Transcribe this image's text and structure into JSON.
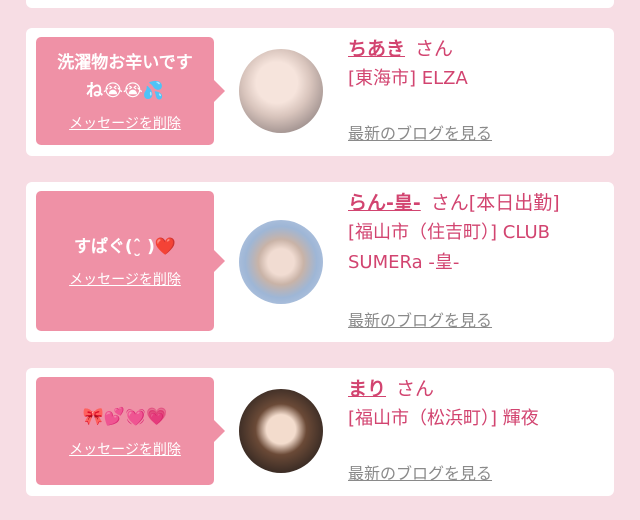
{
  "favorites": [
    {
      "message": "洗濯物お辛いです\nね😭😭💦",
      "delete_label": "メッセージを削除",
      "name": "ちあき",
      "honorific": "さん",
      "shift": "",
      "shop": "[東海市] ELZA",
      "blog_label": "最新のブログを見る"
    },
    {
      "message": "すぱぐ(ˆ̮ )❤️",
      "delete_label": "メッセージを削除",
      "name": "らん-皇-",
      "honorific": "さん",
      "shift": "[本日出勤]",
      "shop": "[福山市（住吉町）] CLUB\nSUMERa -皇-",
      "blog_label": "最新のブログを見る"
    },
    {
      "message": "🎀💕💓💗",
      "delete_label": "メッセージを削除",
      "name": "まり",
      "honorific": "さん",
      "shift": "",
      "shop": "[福山市（松浜町）] 輝夜",
      "blog_label": "最新のブログを見る"
    }
  ]
}
